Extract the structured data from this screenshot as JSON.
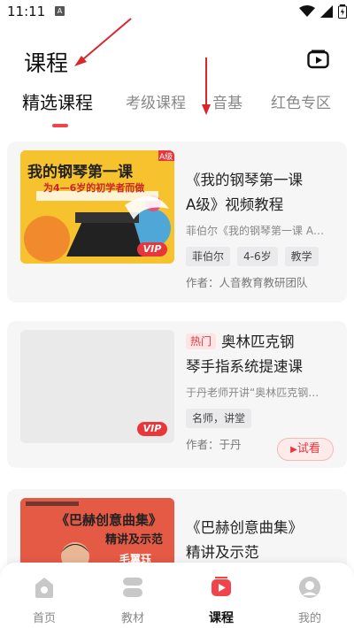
{
  "status": {
    "time": "11:11",
    "notif": "A"
  },
  "header": {
    "title": "课程"
  },
  "tabs": [
    {
      "label": "精选课程",
      "active": true
    },
    {
      "label": "考级课程",
      "active": false
    },
    {
      "label": "音基",
      "active": false
    },
    {
      "label": "红色专区",
      "active": false
    }
  ],
  "courses": [
    {
      "title": "《我的钢琴第一课A级》视频教程",
      "title_line1": "《我的钢琴第一课",
      "title_line2": "A级》视频教程",
      "desc": "菲伯尔《我的钢琴第一课 A…",
      "tags": [
        "菲伯尔",
        "4-6岁",
        "教学"
      ],
      "author": "作者：人音教育教研团队",
      "thumb": {
        "heading": "我的钢琴第一课",
        "level": "A级",
        "subtitle": "为4—6岁的初学者而做",
        "vip": "VIP"
      }
    },
    {
      "hot": "热门",
      "title_line1": "奥林匹克钢",
      "title_line2": "琴手指系统提速课",
      "desc": "于丹老师开讲“奥林匹克钢…",
      "tags": [
        "名师，讲堂"
      ],
      "author": "作者：于丹",
      "try_label": "试看",
      "thumb": {
        "vip": "VIP"
      }
    },
    {
      "title_line1": "《巴赫创意曲集》",
      "title_line2": "精讲及示范",
      "thumb": {
        "heading": "《巴赫创意曲集》",
        "subtitle": "精讲及示范",
        "name": "毛翼珏"
      }
    }
  ],
  "bottom_nav": [
    {
      "label": "首页",
      "icon": "home-icon",
      "active": false
    },
    {
      "label": "教材",
      "icon": "textbook-icon",
      "active": false
    },
    {
      "label": "课程",
      "icon": "course-play-icon",
      "active": true
    },
    {
      "label": "我的",
      "icon": "profile-icon",
      "active": false
    }
  ],
  "colors": {
    "accent": "#e9363b",
    "background": "#ffffff",
    "card": "#f6f6f7"
  }
}
